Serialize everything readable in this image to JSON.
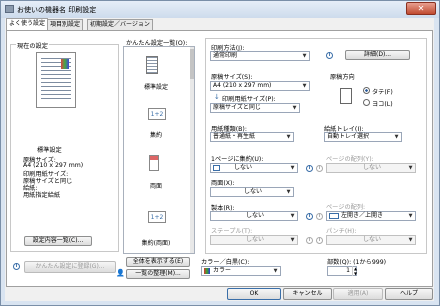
{
  "window": {
    "title": "お使いの機器名 印刷設定",
    "close": "✕"
  },
  "tabs": [
    "よく使う設定",
    "項目別設定",
    "初期設定／バージョン"
  ],
  "current": {
    "group_label": "現在の設定",
    "preset_name": "標準設定",
    "summary": [
      "原稿サイズ:",
      "A4 (210 x 297 mm)",
      "印刷用紙サイズ:",
      "  原稿サイズと同じ",
      "給紙:",
      "  用紙指定給紙"
    ],
    "list_button": "設定内容一覧(C)...",
    "register_button": "かんたん設定に登録(G)..."
  },
  "presets": {
    "label": "かんたん設定一覧(O):",
    "items": [
      "標準設定",
      "集約",
      "両面",
      "集約(両面)"
    ],
    "icon_text": "1+2",
    "show_all": "全体を表示する(E)",
    "manage": "一覧の整理(M)..."
  },
  "settings": {
    "print_method_label": "印刷方法(J):",
    "print_method": "通常印刷",
    "details": "詳細(D)...",
    "paper_size_label": "原稿サイズ(S):",
    "paper_size": "A4 (210 x 297 mm)",
    "print_paper_label": "印刷用紙サイズ(P):",
    "print_paper": "原稿サイズと同じ",
    "orientation_label": "原稿方向",
    "portrait": "タテ(F)",
    "landscape": "ヨコ(L)",
    "paper_type_label": "用紙種類(B):",
    "paper_type": "普通紙・再生紙",
    "tray_label": "給紙トレイ(I):",
    "tray": "自動トレイ選択",
    "nup_label": "1ページに集約(U):",
    "nup": "しない",
    "page_layout_label": "ページの配列(Y):",
    "page_layout": "しない",
    "duplex_label": "両面(X):",
    "duplex": "しない",
    "binding_label": "製本(R):",
    "binding": "しない",
    "binding_dir": "左開き／上開き",
    "staple_label": "ステープル(T):",
    "staple": "しない",
    "punch_label": "パンチ(H):",
    "punch": "しない",
    "color_label": "カラー／白黒(C):",
    "color": "カラー",
    "copies_label": "部数(Q): (1から999)",
    "copies": "1"
  },
  "footer": {
    "ok": "OK",
    "cancel": "キャンセル",
    "apply": "適用(A)",
    "help": "ヘルプ"
  }
}
